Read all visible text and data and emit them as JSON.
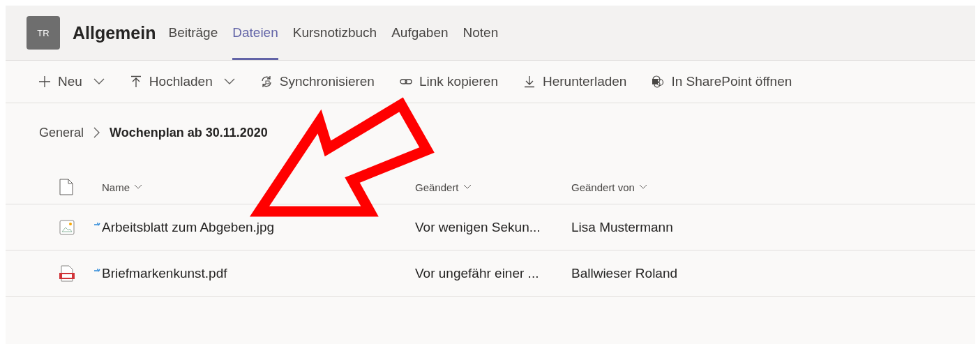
{
  "team": {
    "avatar": "TR",
    "name": "Allgemein"
  },
  "tabs": [
    {
      "label": "Beiträge",
      "selected": false
    },
    {
      "label": "Dateien",
      "selected": true
    },
    {
      "label": "Kursnotizbuch",
      "selected": false
    },
    {
      "label": "Aufgaben",
      "selected": false
    },
    {
      "label": "Noten",
      "selected": false
    }
  ],
  "toolbar": [
    {
      "kind": "new",
      "label": "Neu",
      "dropdown": true
    },
    {
      "kind": "upload",
      "label": "Hochladen",
      "dropdown": true
    },
    {
      "kind": "sync",
      "label": "Synchronisieren",
      "dropdown": false
    },
    {
      "kind": "link",
      "label": "Link kopieren",
      "dropdown": false
    },
    {
      "kind": "download",
      "label": "Herunterladen",
      "dropdown": false
    },
    {
      "kind": "sharepoint",
      "label": "In SharePoint öffnen",
      "dropdown": false
    }
  ],
  "breadcrumb": [
    "General",
    "Wochenplan ab 30.11.2020"
  ],
  "table": {
    "columns": [
      "Name",
      "Geändert",
      "Geändert von"
    ],
    "rows": [
      {
        "kind": "image",
        "name": "Arbeitsblatt zum Abgeben.jpg",
        "modified": "Vor wenigen Sekun...",
        "modified_by": "Lisa Mustermann",
        "syncing": true
      },
      {
        "kind": "pdf",
        "name": "Briefmarkenkunst.pdf",
        "modified": "Vor ungefähr einer ...",
        "modified_by": "Ballwieser Roland",
        "syncing": true
      }
    ]
  }
}
